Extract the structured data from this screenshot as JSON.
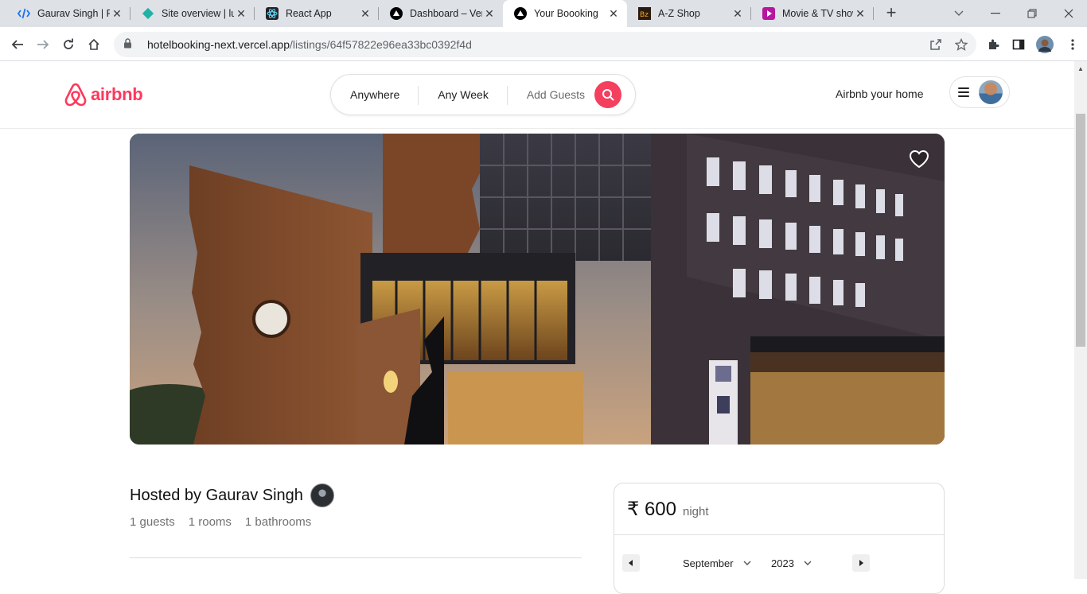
{
  "browser": {
    "tabs": [
      {
        "title": "Gaurav Singh | Fu",
        "icon": "code-icon"
      },
      {
        "title": "Site overview | lu",
        "icon": "netlify-icon"
      },
      {
        "title": "React App",
        "icon": "react-icon"
      },
      {
        "title": "Dashboard – Verc",
        "icon": "vercel-icon"
      },
      {
        "title": "Your Boooking",
        "icon": "vercel-icon",
        "active": true
      },
      {
        "title": "A-Z Shop",
        "icon": "shop-icon"
      },
      {
        "title": "Movie & TV show",
        "icon": "movie-icon"
      }
    ],
    "url_host": "hotelbooking-next.vercel.app",
    "url_path": "/listings/64f57822e96ea33bc0392f4d"
  },
  "header": {
    "brand": "airbnb",
    "search": {
      "where": "Anywhere",
      "when": "Any Week",
      "who": "Add Guests"
    },
    "host_link": "Airbnb your home"
  },
  "listing": {
    "host_title": "Hosted by Gaurav Singh",
    "guests": "1 guests",
    "rooms": "1 rooms",
    "bathrooms": "1 bathrooms"
  },
  "booking": {
    "price": "₹ 600",
    "unit": "night",
    "month": "September",
    "year": "2023"
  },
  "colors": {
    "brand": "#ff385c",
    "search_button": "#f43f5e"
  }
}
